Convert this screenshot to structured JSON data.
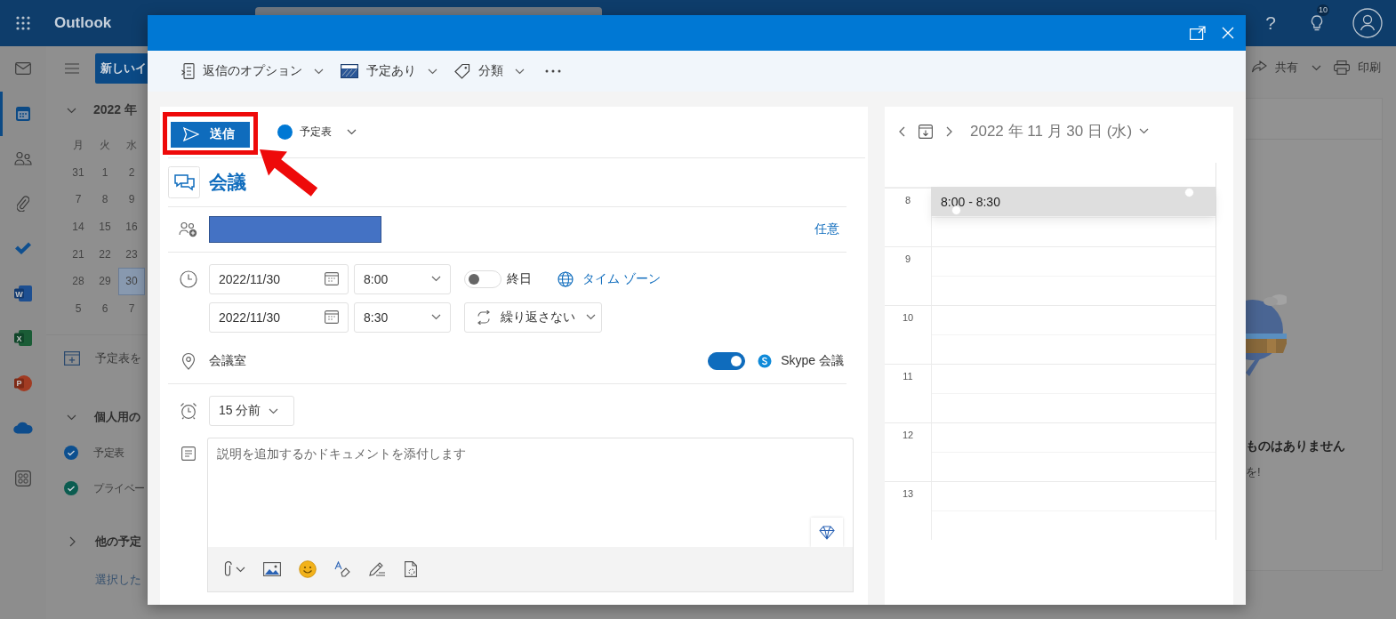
{
  "app_bar": {
    "app_name": "Outlook",
    "help": "?",
    "tips_count": "10"
  },
  "nav_rail": [
    {
      "kind": "mail",
      "selected": false
    },
    {
      "kind": "calendar",
      "selected": true
    },
    {
      "kind": "people",
      "selected": false
    },
    {
      "kind": "files",
      "selected": false
    },
    {
      "kind": "todo",
      "selected": false
    },
    {
      "kind": "word",
      "letter": "W",
      "selected": false
    },
    {
      "kind": "excel",
      "letter": "X",
      "selected": false
    },
    {
      "kind": "powerpoint",
      "letter": "P",
      "selected": false
    },
    {
      "kind": "onedrive",
      "selected": false
    },
    {
      "kind": "apps",
      "selected": false
    }
  ],
  "sidebar": {
    "new_button": "新しいイ",
    "month_label": "2022 年",
    "weekdays": [
      "月",
      "火",
      "水"
    ],
    "weeks": [
      [
        {
          "day": "31",
          "selected": false
        },
        {
          "day": "1",
          "selected": false
        },
        {
          "day": "2",
          "selected": false
        }
      ],
      [
        {
          "day": "7",
          "selected": false
        },
        {
          "day": "8",
          "selected": false
        },
        {
          "day": "9",
          "selected": false
        }
      ],
      [
        {
          "day": "14",
          "selected": false
        },
        {
          "day": "15",
          "selected": false
        },
        {
          "day": "16",
          "selected": false
        }
      ],
      [
        {
          "day": "21",
          "selected": false
        },
        {
          "day": "22",
          "selected": false
        },
        {
          "day": "23",
          "selected": false
        }
      ],
      [
        {
          "day": "28",
          "selected": false
        },
        {
          "day": "29",
          "selected": false
        },
        {
          "day": "30",
          "selected": true
        }
      ],
      [
        {
          "day": "5",
          "selected": false
        },
        {
          "day": "6",
          "selected": false
        },
        {
          "day": "7",
          "selected": false
        }
      ]
    ],
    "add_calendar": "予定表を",
    "groups": [
      {
        "label": "個人用の",
        "expanded": true,
        "calendars": [
          {
            "label": "予定表",
            "color": "#0c4f8f",
            "checked": true
          },
          {
            "label": "プライベー",
            "color": "#0b5c50",
            "checked": true
          }
        ]
      },
      {
        "label": "他の予定",
        "expanded": false
      }
    ],
    "footer_link": "選択した"
  },
  "page_toolbar": [
    {
      "kind": "share",
      "label": "共有"
    },
    {
      "kind": "print",
      "label": "印刷"
    }
  ],
  "empty_state": {
    "title": "ものはありません",
    "subtitle": "を!"
  },
  "dialog": {
    "toolbar": [
      {
        "kind": "response",
        "label": "返信のオプション"
      },
      {
        "kind": "show_as",
        "label": "予定あり"
      },
      {
        "kind": "category",
        "label": "分類"
      },
      {
        "kind": "more"
      }
    ],
    "send_button": "送信",
    "calendar": {
      "label": "予定表",
      "color": "#0078d4"
    },
    "title": "会議",
    "attendee_mode": "任意",
    "start": {
      "date": "2022/11/30",
      "time": "8:00"
    },
    "end": {
      "date": "2022/11/30",
      "time": "8:30"
    },
    "all_day": {
      "label": "終日",
      "on": false
    },
    "time_zone": "タイム ゾーン",
    "repeat": "繰り返さない",
    "location": "会議室",
    "online_meeting": {
      "label": "Skype 会議",
      "on": true
    },
    "reminder": "15 分前",
    "description": {
      "placeholder": "説明を追加するかドキュメントを添付します"
    }
  },
  "day_view": {
    "date_label": "2022 年 11 月 30 日 (水)",
    "hours": [
      "8",
      "9",
      "10",
      "11",
      "12",
      "13"
    ],
    "event": {
      "time": "8:00 - 8:30"
    }
  }
}
